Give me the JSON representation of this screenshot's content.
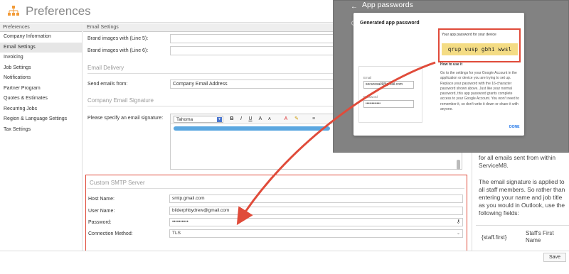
{
  "app": {
    "title": "Preferences"
  },
  "sidebar": {
    "header": "Preferences",
    "items": [
      {
        "label": "Company Information"
      },
      {
        "label": "Email Settings"
      },
      {
        "label": "Invoicing"
      },
      {
        "label": "Job Settings"
      },
      {
        "label": "Notifications"
      },
      {
        "label": "Partner Program"
      },
      {
        "label": "Quotes & Estimates"
      },
      {
        "label": "Recurring Jobs"
      },
      {
        "label": "Region & Language Settings"
      },
      {
        "label": "Tax Settings"
      }
    ]
  },
  "content": {
    "header": "Email Settings",
    "brand_line5_label": "Brand images with (Line 5):",
    "brand_line5_value": "",
    "brand_line6_label": "Brand images with (Line 6):",
    "brand_line6_value": "",
    "email_delivery_title": "Email Delivery",
    "send_from_label": "Send emails from:",
    "send_from_value": "Company Email Address",
    "signature_title": "Company Email Signature",
    "signature_label": "Please specify an email signature:",
    "editor_font": "Tahoma",
    "editor_buttons": {
      "bold": "B",
      "italic": "I",
      "underline": "U",
      "font_up": "A",
      "font_down": "A"
    }
  },
  "smtp": {
    "title": "Custom SMTP Server",
    "host_label": "Host Name:",
    "host_value": "smtp.gmail.com",
    "user_label": "User Name:",
    "user_value": "bilderphbydrew@gmail.com",
    "password_label": "Password:",
    "password_value": "••••••••••",
    "method_label": "Connection Method:",
    "method_value": "TLS"
  },
  "right_panel": {
    "text_a": "for all emails sent from within ServiceM8.",
    "text_b": "The email signature is applied to all staff members. So rather than entering your name and job title as you would in Outlook, use the following fields:",
    "table_key": "{staff.first}",
    "table_value": "Staff's First Name"
  },
  "footer": {
    "save_label": "Save"
  },
  "overlay": {
    "title": "App passwords",
    "dialog_title": "Generated app password",
    "pw_label": "Your app password for your device",
    "pw_value": "qrup vusp gbhi wwsl",
    "howto_title": "How to use it",
    "howto_body": "Go to the settings for your Google Account in the application or device you are trying to set up. Replace your password with the 16-character password shown above. Just like your normal password, this app password grants complete access to your Google Account. You won't need to remember it, so don't write it down or share it with anyone.",
    "email_label": "Email",
    "email_value": "securesal4@gmail.com",
    "password_label": "Password",
    "password_value": "••••••••••••",
    "done_label": "DONE"
  },
  "colors": {
    "highlight_red": "#e04b3a",
    "logo_orange": "#f29b38",
    "password_highlight": "#f4dc84"
  }
}
